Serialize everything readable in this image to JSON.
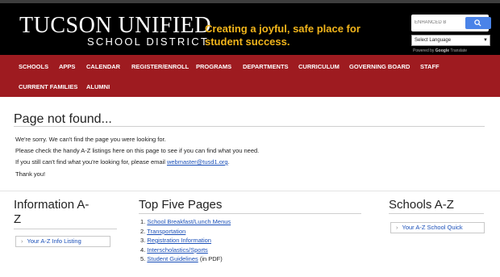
{
  "header": {
    "logo_main": "TUCSON UNIFIED",
    "logo_sub": "SCHOOL DISTRICT",
    "tagline": "Creating a joyful, safe place for student success.",
    "search_placeholder": "ENHANCED B",
    "search_icon": "search-icon",
    "language_select": "Select Language",
    "powered_by_prefix": "Powered by",
    "powered_by_brand": "Google",
    "powered_by_suffix": "Translate"
  },
  "nav": {
    "items": [
      "SCHOOLS",
      "APPS",
      "CALENDAR",
      "REGISTER/ENROLL",
      "PROGRAMS",
      "DEPARTMENTS",
      "CURRICULUM",
      "GOVERNING BOARD",
      "STAFF",
      "CURRENT FAMILIES",
      "ALUMNI"
    ]
  },
  "main": {
    "title": "Page not found...",
    "line1": "We're sorry. We can't find the page you were looking for.",
    "line2": "Please check the handy A-Z listings here on this page to see if you can find what you need.",
    "line3_prefix": "If you still can't find what you're looking for, please email ",
    "line3_email": "webmaster@tusd1.org",
    "line3_suffix": ".",
    "line4": "Thank you!"
  },
  "info_az": {
    "heading_line1": "Information A-",
    "heading_line2": "Z",
    "button": "Your A-Z Info Listing"
  },
  "top_five": {
    "heading": "Top Five Pages",
    "items": [
      {
        "num": "1.",
        "link": "School Breakfast/Lunch Menus",
        "suffix": ""
      },
      {
        "num": "2.",
        "link": "Transportation",
        "suffix": ""
      },
      {
        "num": "3.",
        "link": "Registration Information",
        "suffix": ""
      },
      {
        "num": "4.",
        "link": "Interscholastics/Sports",
        "suffix": ""
      },
      {
        "num": "5.",
        "link": "Student Guidelines",
        "suffix": " (in PDF)"
      }
    ]
  },
  "schools_az": {
    "heading": "Schools A-Z",
    "button": "Your A-Z School Quick"
  },
  "colors": {
    "header_bg": "#000000",
    "nav_bg": "#9e1b20",
    "tagline": "#f2b51b",
    "link": "#1a4fb8"
  }
}
